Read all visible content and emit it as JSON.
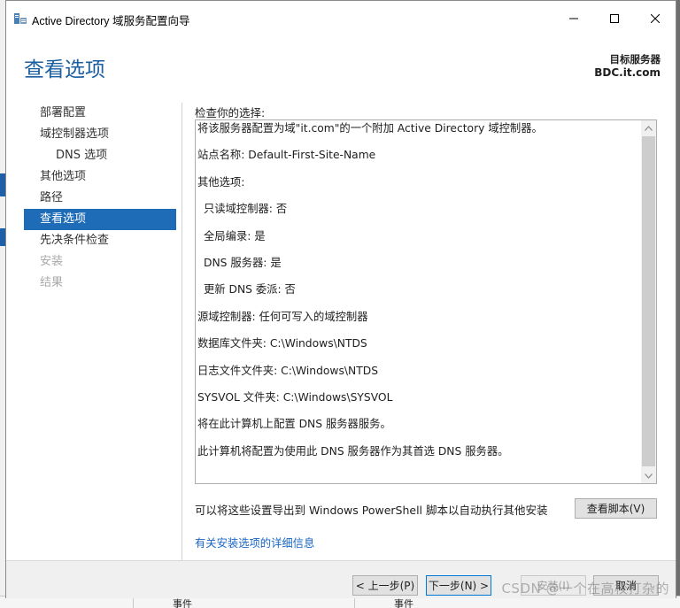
{
  "window": {
    "title": "Active Directory 域服务配置向导"
  },
  "header": {
    "page_title": "查看选项",
    "target_label": "目标服务器",
    "target_name": "BDC.it.com"
  },
  "nav": {
    "items": [
      {
        "label": "部署配置",
        "state": "normal"
      },
      {
        "label": "域控制器选项",
        "state": "normal"
      },
      {
        "label": "DNS 选项",
        "state": "sub"
      },
      {
        "label": "其他选项",
        "state": "normal"
      },
      {
        "label": "路径",
        "state": "normal"
      },
      {
        "label": "查看选项",
        "state": "active"
      },
      {
        "label": "先决条件检查",
        "state": "normal"
      },
      {
        "label": "安装",
        "state": "disabled"
      },
      {
        "label": "结果",
        "state": "disabled"
      }
    ]
  },
  "review": {
    "label": "检查你的选择:",
    "lines": [
      {
        "text": "将该服务器配置为域\"it.com\"的一个附加 Active Directory 域控制器。",
        "indent": false
      },
      {
        "text": "站点名称: Default-First-Site-Name",
        "indent": false
      },
      {
        "text": "其他选项:",
        "indent": false
      },
      {
        "text": "只读域控制器: 否",
        "indent": true
      },
      {
        "text": "全局编录: 是",
        "indent": true
      },
      {
        "text": "DNS 服务器: 是",
        "indent": true
      },
      {
        "text": "更新 DNS 委派: 否",
        "indent": true
      },
      {
        "text": "源域控制器: 任何可写入的域控制器",
        "indent": false
      },
      {
        "text": "数据库文件夹: C:\\Windows\\NTDS",
        "indent": false
      },
      {
        "text": "日志文件文件夹: C:\\Windows\\NTDS",
        "indent": false
      },
      {
        "text": "SYSVOL 文件夹: C:\\Windows\\SYSVOL",
        "indent": false
      },
      {
        "text": "将在此计算机上配置 DNS 服务器服务。",
        "indent": false
      },
      {
        "text": "此计算机将配置为使用此 DNS 服务器作为其首选 DNS 服务器。",
        "indent": false
      }
    ]
  },
  "export": {
    "text": "可以将这些设置导出到 Windows PowerShell 脚本以自动执行其他安装",
    "button_label": "查看脚本(V)"
  },
  "more_link": "有关安装选项的详细信息",
  "footer": {
    "prev_label": "< 上一步(P)",
    "next_label": "下一步(N) >",
    "install_label": "安装(I)",
    "cancel_label": "取消"
  },
  "background": {
    "bottom_col_1": "事件",
    "bottom_col_2": "事件"
  },
  "watermark": "CSDN @一个在高校打杂的",
  "colors": {
    "accent": "#1b5fa0",
    "nav_active": "#1e6bb8",
    "link": "#1a66c2"
  }
}
